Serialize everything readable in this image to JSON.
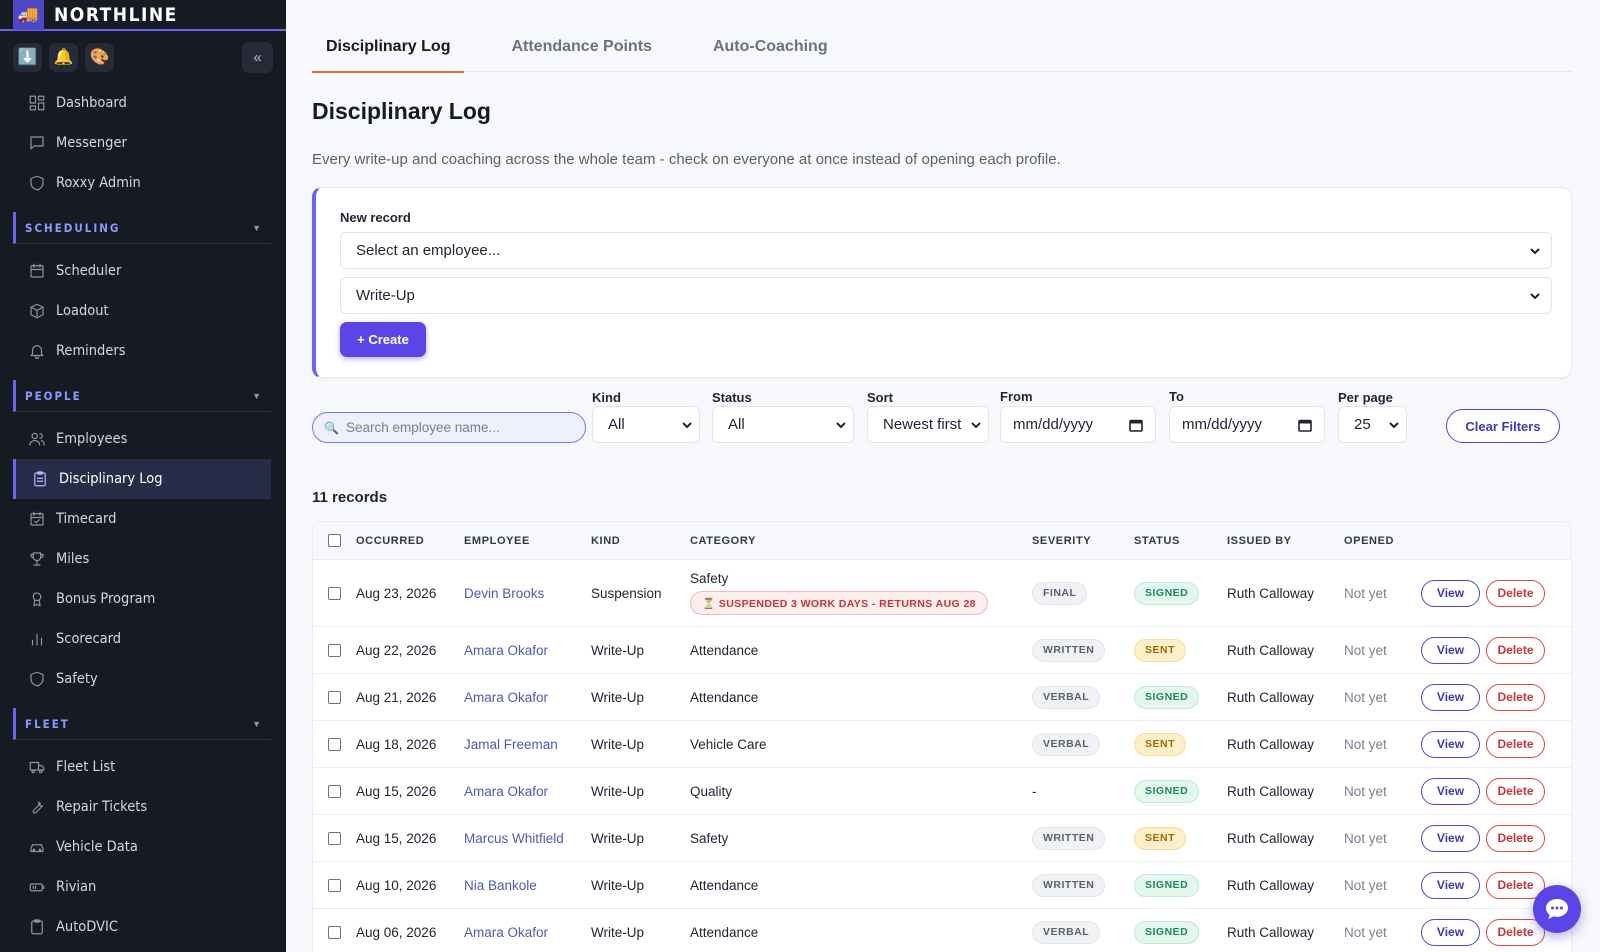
{
  "brand": {
    "name": "NORTHLINE",
    "logo_icon": "truck-icon"
  },
  "quick_actions": [
    {
      "name": "download-icon",
      "glyph": "⬇️"
    },
    {
      "name": "bell-icon",
      "glyph": "🔔"
    },
    {
      "name": "palette-icon",
      "glyph": "🎨"
    }
  ],
  "sidebar": {
    "collapse_glyph": "«",
    "top_items": [
      {
        "label": "Dashboard",
        "icon": "dashboard-icon"
      },
      {
        "label": "Messenger",
        "icon": "chat-icon"
      },
      {
        "label": "Roxxy Admin",
        "icon": "shield-icon"
      }
    ],
    "sections": [
      {
        "label": "SCHEDULING",
        "items": [
          {
            "label": "Scheduler",
            "icon": "calendar-icon"
          },
          {
            "label": "Loadout",
            "icon": "box-icon"
          },
          {
            "label": "Reminders",
            "icon": "bell-icon"
          }
        ]
      },
      {
        "label": "PEOPLE",
        "items": [
          {
            "label": "Employees",
            "icon": "users-icon"
          },
          {
            "label": "Disciplinary Log",
            "icon": "clipboard-icon",
            "active": true
          },
          {
            "label": "Timecard",
            "icon": "calendar-check-icon"
          },
          {
            "label": "Miles",
            "icon": "trophy-icon"
          },
          {
            "label": "Bonus Program",
            "icon": "award-icon"
          },
          {
            "label": "Scorecard",
            "icon": "bar-chart-icon"
          },
          {
            "label": "Safety",
            "icon": "shield-icon"
          }
        ]
      },
      {
        "label": "FLEET",
        "items": [
          {
            "label": "Fleet List",
            "icon": "truck-icon"
          },
          {
            "label": "Repair Tickets",
            "icon": "wrench-icon"
          },
          {
            "label": "Vehicle Data",
            "icon": "car-icon"
          },
          {
            "label": "Rivian",
            "icon": "battery-icon"
          },
          {
            "label": "AutoDVIC",
            "icon": "clipboard-icon"
          }
        ]
      }
    ]
  },
  "tabs": [
    "Disciplinary Log",
    "Attendance Points",
    "Auto-Coaching"
  ],
  "page": {
    "title": "Disciplinary Log",
    "description": "Every write-up and coaching across the whole team - check on everyone at once instead of opening each profile."
  },
  "new_record": {
    "label": "New record",
    "employee_select": "Select an employee...",
    "kind_select": "Write-Up",
    "create_label": "+ Create"
  },
  "filters": {
    "search_placeholder": "Search employee name...",
    "kind_label": "Kind",
    "kind_value": "All",
    "status_label": "Status",
    "status_value": "All",
    "sort_label": "Sort",
    "sort_value": "Newest first",
    "from_label": "From",
    "from_value": "mm/dd/yyyy",
    "to_label": "To",
    "to_value": "mm/dd/yyyy",
    "per_page_label": "Per page",
    "per_page_value": "25",
    "clear_label": "Clear Filters"
  },
  "records_count": "11 records",
  "table": {
    "columns": [
      "OCCURRED",
      "EMPLOYEE",
      "KIND",
      "CATEGORY",
      "SEVERITY",
      "STATUS",
      "ISSUED BY",
      "OPENED"
    ],
    "view_label": "View",
    "delete_label": "Delete",
    "rows": [
      {
        "occurred": "Aug 23, 2026",
        "employee": "Devin Brooks",
        "kind": "Suspension",
        "category": "Safety",
        "note": "⏳ SUSPENDED 3 WORK DAYS - RETURNS AUG 28",
        "severity": "FINAL",
        "status": "SIGNED",
        "issued_by": "Ruth Calloway",
        "opened": "Not yet"
      },
      {
        "occurred": "Aug 22, 2026",
        "employee": "Amara Okafor",
        "kind": "Write-Up",
        "category": "Attendance",
        "severity": "WRITTEN",
        "status": "SENT",
        "issued_by": "Ruth Calloway",
        "opened": "Not yet"
      },
      {
        "occurred": "Aug 21, 2026",
        "employee": "Amara Okafor",
        "kind": "Write-Up",
        "category": "Attendance",
        "severity": "VERBAL",
        "status": "SIGNED",
        "issued_by": "Ruth Calloway",
        "opened": "Not yet"
      },
      {
        "occurred": "Aug 18, 2026",
        "employee": "Jamal Freeman",
        "kind": "Write-Up",
        "category": "Vehicle Care",
        "severity": "VERBAL",
        "status": "SENT",
        "issued_by": "Ruth Calloway",
        "opened": "Not yet"
      },
      {
        "occurred": "Aug 15, 2026",
        "employee": "Amara Okafor",
        "kind": "Write-Up",
        "category": "Quality",
        "severity": "-",
        "status": "SIGNED",
        "issued_by": "Ruth Calloway",
        "opened": "Not yet"
      },
      {
        "occurred": "Aug 15, 2026",
        "employee": "Marcus Whitfield",
        "kind": "Write-Up",
        "category": "Safety",
        "severity": "WRITTEN",
        "status": "SENT",
        "issued_by": "Ruth Calloway",
        "opened": "Not yet"
      },
      {
        "occurred": "Aug 10, 2026",
        "employee": "Nia Bankole",
        "kind": "Write-Up",
        "category": "Attendance",
        "severity": "WRITTEN",
        "status": "SIGNED",
        "issued_by": "Ruth Calloway",
        "opened": "Not yet"
      },
      {
        "occurred": "Aug 06, 2026",
        "employee": "Amara Okafor",
        "kind": "Write-Up",
        "category": "Attendance",
        "severity": "VERBAL",
        "status": "SIGNED",
        "issued_by": "Ruth Calloway",
        "opened": "Not yet"
      }
    ]
  },
  "chat": {
    "icon": "chat-bubble-icon"
  },
  "colors": {
    "accent": "#5b45e6",
    "sidebar_bg": "#161a23",
    "active_tab": "#e46b2c",
    "signed": "#1d8a58",
    "sent": "#9a6a05",
    "danger": "#c73636"
  }
}
